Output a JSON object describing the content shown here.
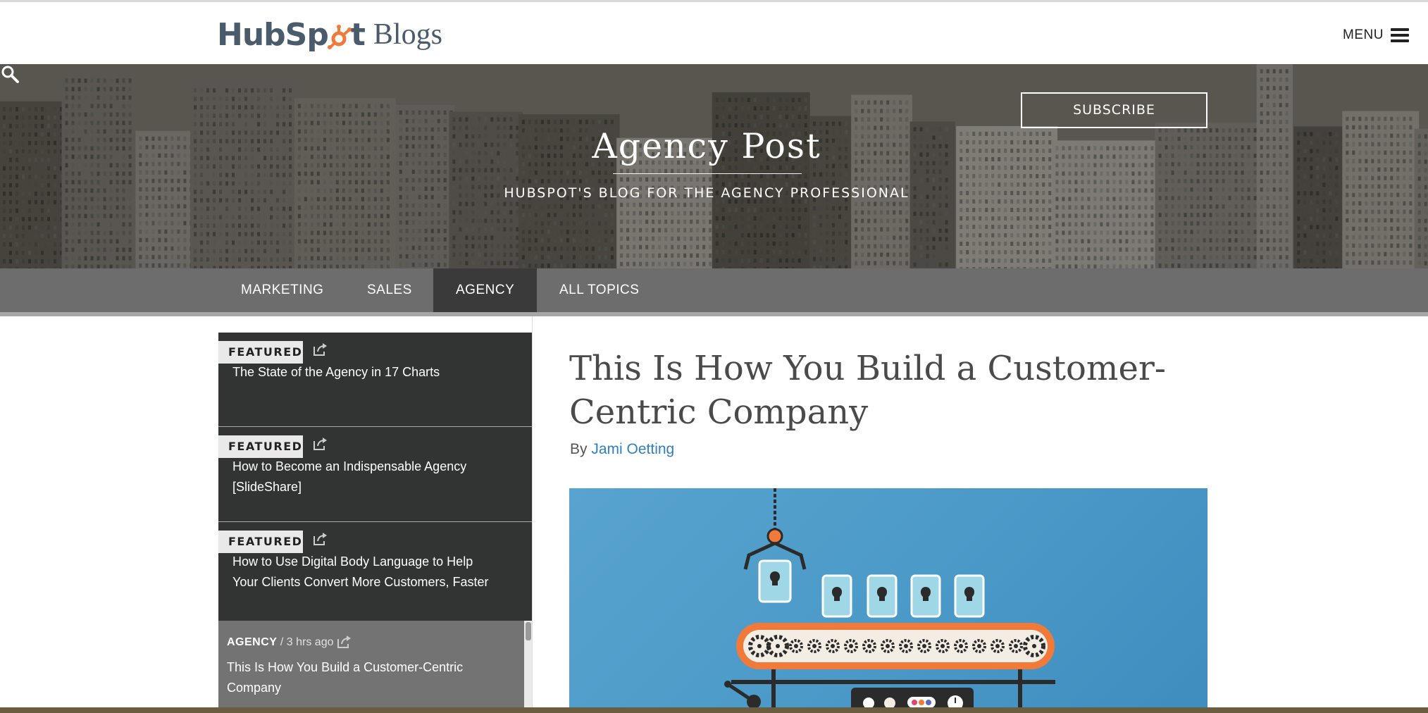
{
  "header": {
    "logo_hub": "HubSp",
    "logo_t": "t",
    "logo_blogs": "Blogs",
    "menu_label": "MENU"
  },
  "hero": {
    "title": "Agency Post",
    "subtitle": "HUBSPOT'S BLOG FOR THE AGENCY PROFESSIONAL",
    "subscribe_label": "SUBSCRIBE"
  },
  "nav": {
    "items": [
      {
        "label": "MARKETING"
      },
      {
        "label": "SALES"
      },
      {
        "label": "AGENCY"
      },
      {
        "label": "ALL TOPICS"
      }
    ],
    "active_index": 2
  },
  "sidebar": {
    "featured": [
      {
        "tag": "FEATURED",
        "title": "The State of the Agency in 17 Charts"
      },
      {
        "tag": "FEATURED",
        "title": "How to Become an Indispensable Agency [SlideShare]"
      },
      {
        "tag": "FEATURED",
        "title": "How to Use Digital Body Language to Help Your Clients Convert More Customers, Faster"
      }
    ],
    "recent": {
      "category": "AGENCY",
      "time": " / 3 hrs ago",
      "title": "This Is How You Build a Customer-Centric Company"
    }
  },
  "article": {
    "title": "This Is How You Build a Customer-Centric Company",
    "by": "By ",
    "author": "Jami Oetting"
  },
  "colors": {
    "brand_orange": "#f07a3a",
    "link_blue": "#2f7fc3",
    "nav_bg": "#6d6d6d",
    "nav_active": "#3a3a3a",
    "featured_bg": "#323433",
    "image_blue": "#4c9ac8"
  },
  "icons": [
    "sprocket-logo-icon",
    "hamburger-icon",
    "search-icon",
    "share-icon"
  ]
}
